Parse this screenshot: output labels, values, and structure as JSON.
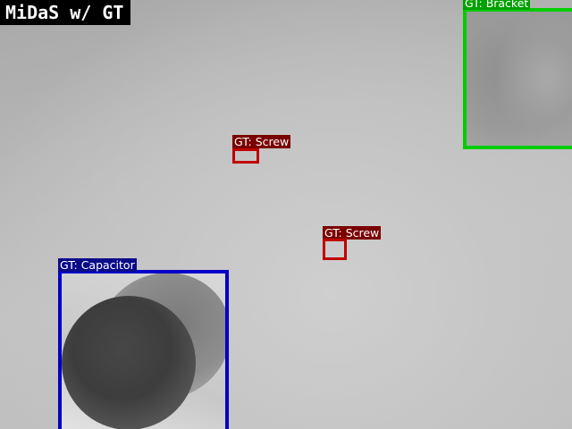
{
  "title": "MiDaS w/ GT",
  "annotations": [
    {
      "id": "bracket",
      "label": "GT: Bracket",
      "color": "#00cc00"
    },
    {
      "id": "screw1",
      "label": "GT: Screw",
      "color": "#c00000"
    },
    {
      "id": "screw2",
      "label": "GT: Screw",
      "color": "#c00000"
    },
    {
      "id": "capacitor",
      "label": "GT: Capacitor",
      "color": "#0000c8"
    }
  ]
}
